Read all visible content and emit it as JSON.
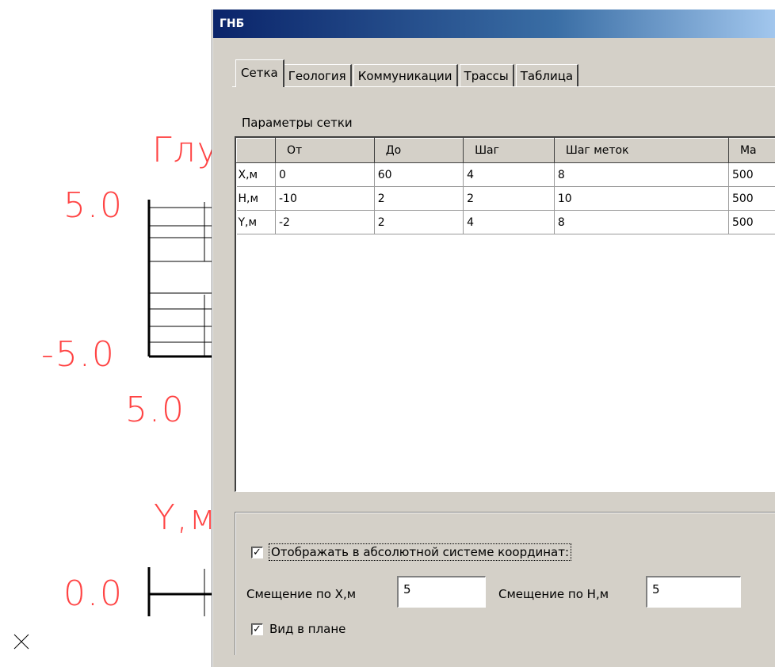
{
  "cad": {
    "label_glu": "Глу",
    "label_y": "Y,м",
    "value_5_0_top": "5.0",
    "value_neg_5_0": "-5.0",
    "value_5_0_bottom": "5.0",
    "value_0_0": "0.0",
    "text_color": "#ff4444"
  },
  "dialog": {
    "title": "ГНБ",
    "tabs": [
      "Сетка",
      "Геология",
      "Коммуникации",
      "Трассы",
      "Таблица"
    ],
    "active_tab": "Сетка",
    "section_label": "Параметры сетки",
    "grid": {
      "columns": [
        "",
        "От",
        "До",
        "Шаг",
        "Шаг меток",
        "Ма"
      ],
      "rows": [
        [
          "X,м",
          "0",
          "60",
          "4",
          "8",
          "500"
        ],
        [
          "H,м",
          "-10",
          "2",
          "2",
          "10",
          "500"
        ],
        [
          "Y,м",
          "-2",
          "2",
          "4",
          "8",
          "500"
        ]
      ]
    },
    "absolute_coords": {
      "label": "Отображать в абсолютной системе координат:",
      "checked": true
    },
    "offset_x": {
      "label": "Смещение по X,м",
      "value": "5"
    },
    "offset_h": {
      "label": "Смещение по H,м",
      "value": "5"
    },
    "plan_view": {
      "label": "Вид в плане",
      "checked": true
    }
  }
}
